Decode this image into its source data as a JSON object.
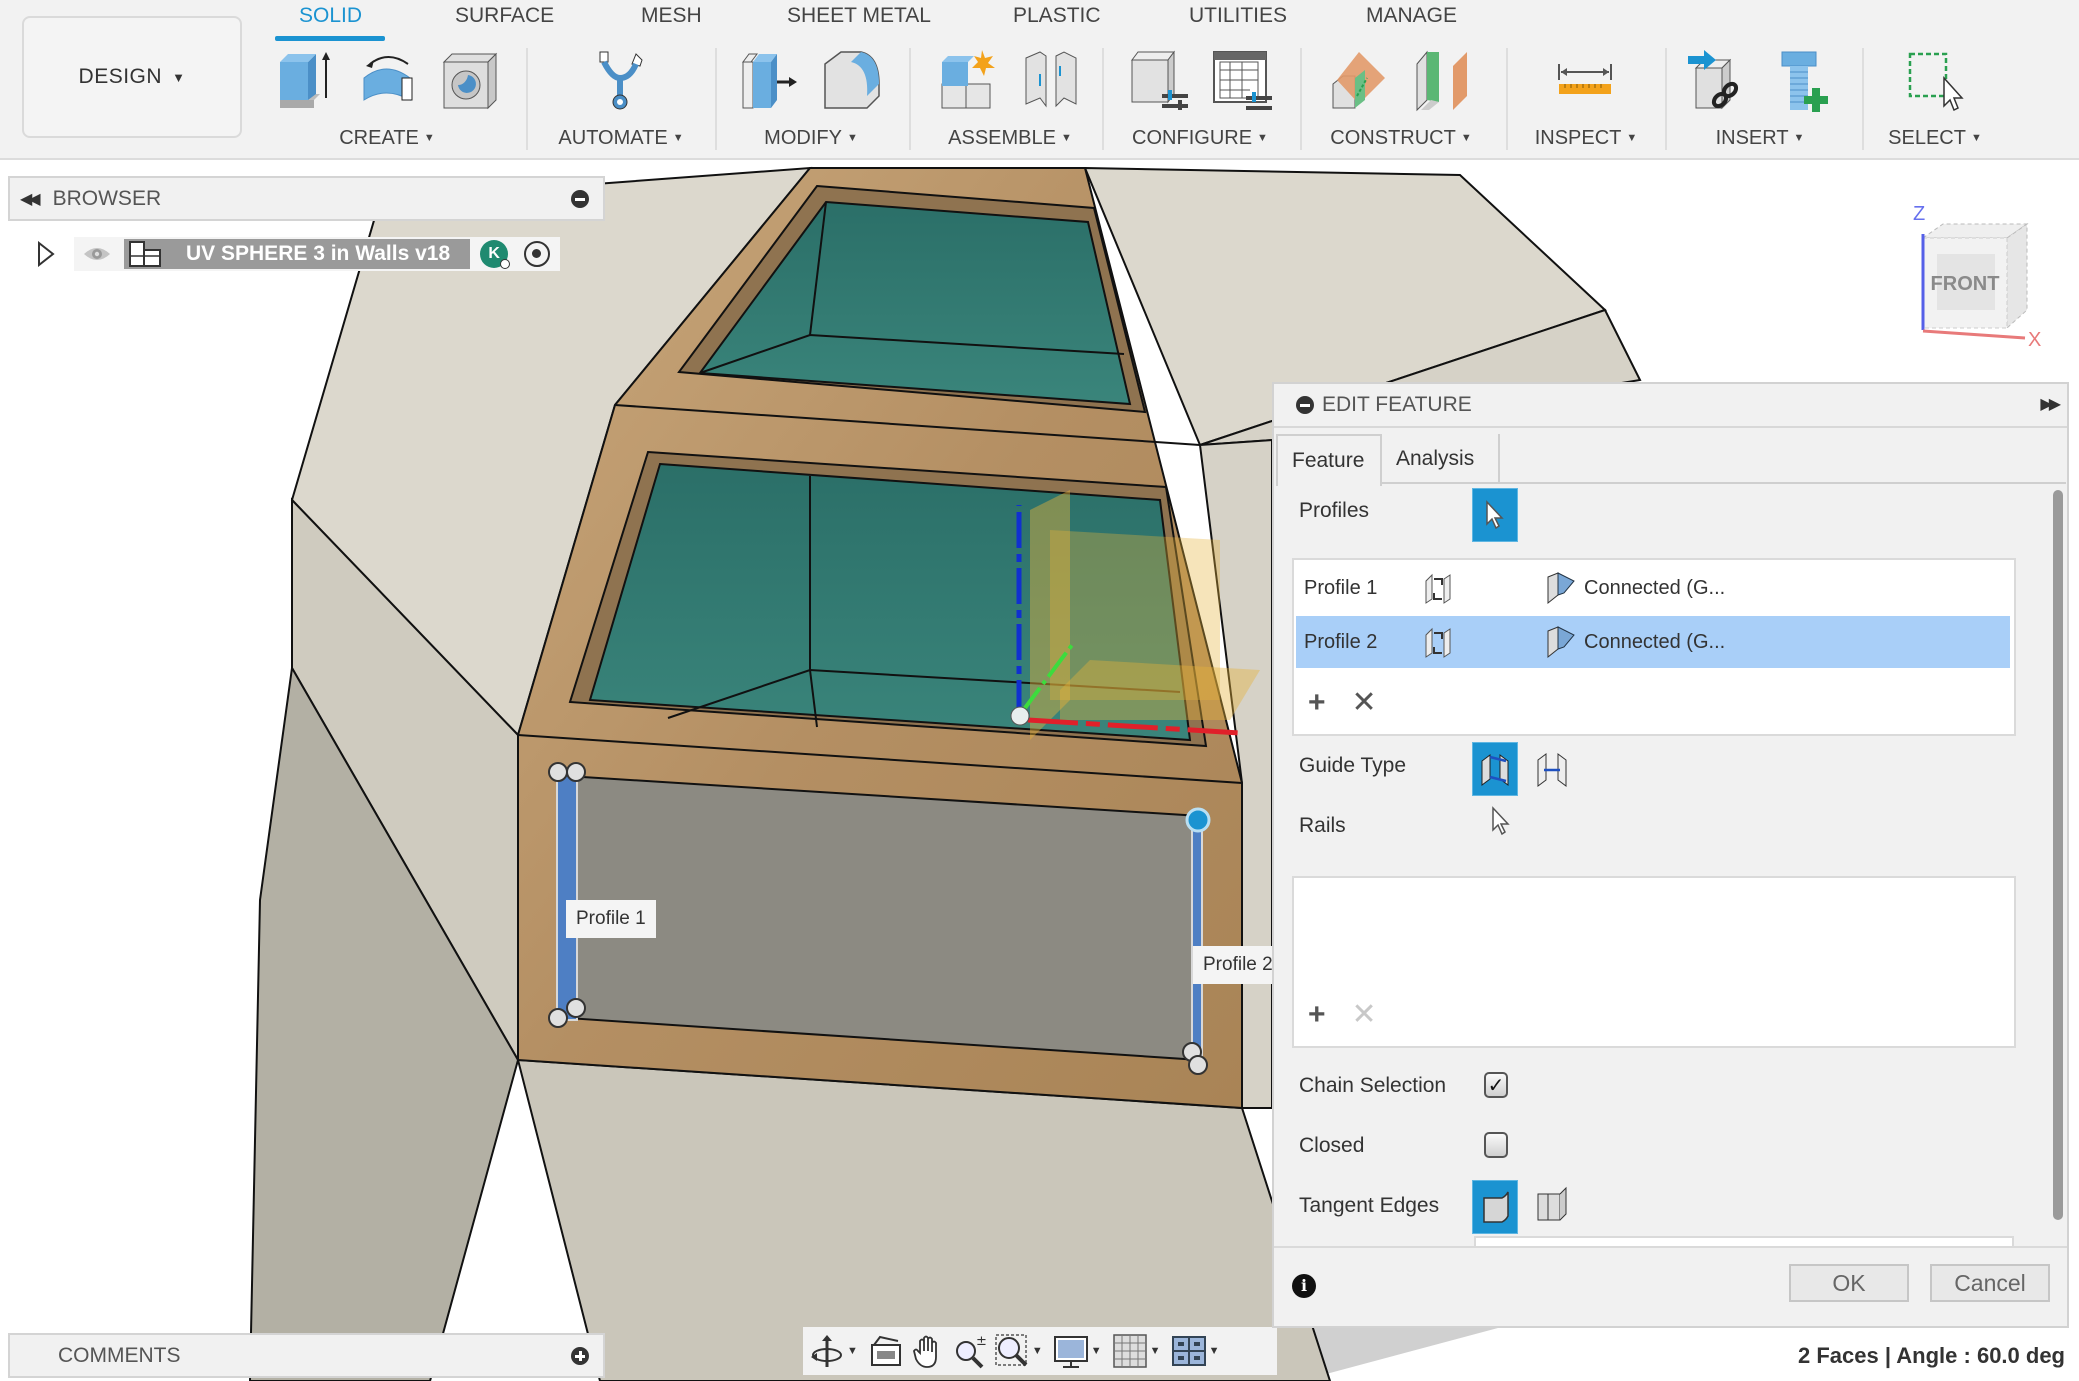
{
  "toolbar": {
    "workspace": "DESIGN",
    "tabs": [
      {
        "label": "SOLID",
        "active": true
      },
      {
        "label": "SURFACE",
        "active": false
      },
      {
        "label": "MESH",
        "active": false
      },
      {
        "label": "SHEET METAL",
        "active": false
      },
      {
        "label": "PLASTIC",
        "active": false
      },
      {
        "label": "UTILITIES",
        "active": false
      },
      {
        "label": "MANAGE",
        "active": false
      }
    ],
    "groups": [
      {
        "label": "CREATE",
        "icons": [
          "extrude-icon",
          "revolve-icon",
          "hole-icon"
        ]
      },
      {
        "label": "AUTOMATE",
        "icons": [
          "automate-icon"
        ]
      },
      {
        "label": "MODIFY",
        "icons": [
          "press-pull-icon",
          "fillet-icon"
        ]
      },
      {
        "label": "ASSEMBLE",
        "icons": [
          "new-component-icon",
          "joint-icon"
        ]
      },
      {
        "label": "CONFIGURE",
        "icons": [
          "configure-icon",
          "configuration-table-icon"
        ]
      },
      {
        "label": "CONSTRUCT",
        "icons": [
          "offset-plane-icon",
          "midplane-icon"
        ]
      },
      {
        "label": "INSPECT",
        "icons": [
          "measure-icon"
        ]
      },
      {
        "label": "INSERT",
        "icons": [
          "insert-derive-icon",
          "insert-fastener-icon"
        ]
      },
      {
        "label": "SELECT",
        "icons": [
          "window-select-icon"
        ]
      }
    ]
  },
  "browser": {
    "title": "BROWSER",
    "root": {
      "name": "UV SPHERE 3 in Walls v18",
      "badge": "K"
    }
  },
  "comments": {
    "title": "COMMENTS"
  },
  "viewcube": {
    "face": "FRONT",
    "axis_z": "Z",
    "axis_x": "X"
  },
  "viewport": {
    "labels": [
      {
        "text": "Profile 1"
      },
      {
        "text": "Profile 2"
      }
    ]
  },
  "edit_feature": {
    "title": "EDIT FEATURE",
    "tabs": [
      {
        "label": "Feature",
        "active": true
      },
      {
        "label": "Analysis",
        "active": false
      }
    ],
    "profiles_label": "Profiles",
    "profiles": [
      {
        "name": "Profile 1",
        "continuity": "Connected (G...",
        "selected": false
      },
      {
        "name": "Profile 2",
        "continuity": "Connected (G...",
        "selected": true
      }
    ],
    "guide_type_label": "Guide Type",
    "rails_label": "Rails",
    "chain_selection_label": "Chain Selection",
    "chain_selection": true,
    "closed_label": "Closed",
    "closed": false,
    "tangent_edges_label": "Tangent Edges",
    "ok_label": "OK",
    "cancel_label": "Cancel",
    "add_symbol": "+",
    "remove_symbol": "✕"
  },
  "status": {
    "text": "2 Faces | Angle : 60.0 deg"
  },
  "nav_tools": [
    "orbit-icon",
    "look-at-icon",
    "pan-icon",
    "zoom-icon",
    "fit-icon",
    "display-settings-icon",
    "grid-icon",
    "viewports-icon"
  ],
  "colors": {
    "accent": "#1b93d1",
    "selected_row": "#a9cff8",
    "teal_surface": "#2f7a72",
    "wood": "#b8966a"
  }
}
